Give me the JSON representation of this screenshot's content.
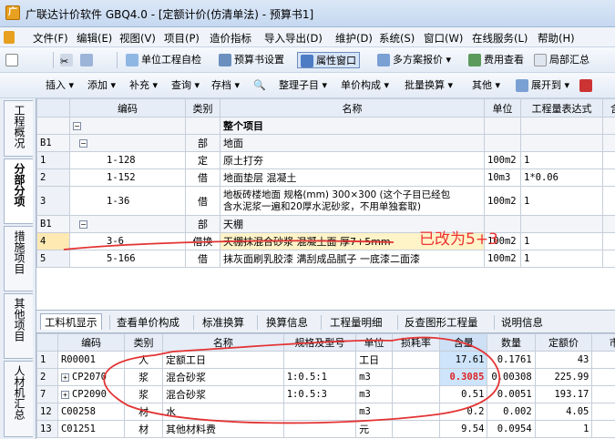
{
  "window": {
    "title": "广联达计价软件 GBQ4.0 - [定额计价(仿清单法) - 预算书1]",
    "app_icon": "广"
  },
  "menu": [
    "文件(F)",
    "编辑(E)",
    "视图(V)",
    "项目(P)",
    "造价指标",
    "导入导出(D)",
    "维护(D)",
    "系统(S)",
    "窗口(W)",
    "在线服务(L)",
    "帮助(H)"
  ],
  "toolbar1": {
    "unit_check": "单位工程自检",
    "budget_settings": "预算书设置",
    "props": "属性窗口",
    "multi_quote": "多方案报价",
    "fee_view": "费用查看",
    "local_summary": "局部汇总"
  },
  "toolbar2": {
    "insert": "插入",
    "add": "添加",
    "fill": "补充",
    "query": "查询",
    "save": "存档",
    "sort": "整理子目",
    "unit_compose": "单价构成",
    "batch_convert": "批量换算",
    "other": "其他",
    "expand": "展开到"
  },
  "side_tabs": [
    "工程概况",
    "分部分项",
    "措施项目",
    "其他项目",
    "人材机汇总"
  ],
  "grid": {
    "headers": [
      "",
      "编码",
      "类别",
      "名称",
      "单位",
      "工程量表达式",
      "含量"
    ],
    "rows": [
      {
        "no": "",
        "code": "",
        "cat": "",
        "name": "整个项目",
        "unit": "",
        "expr": "",
        "qty": ""
      },
      {
        "no": "B1",
        "code": "",
        "cat": "部",
        "name": "地面",
        "unit": "",
        "expr": "",
        "qty": ""
      },
      {
        "no": "1",
        "code": "1-128",
        "cat": "定",
        "name": "原土打夯",
        "unit": "100m2",
        "expr": "1",
        "qty": ""
      },
      {
        "no": "2",
        "code": "1-152",
        "cat": "借",
        "name": "地面垫层 混凝土",
        "unit": "10m3",
        "expr": "1*0.06",
        "qty": ""
      },
      {
        "no": "3",
        "code": "1-36",
        "cat": "借",
        "name": "地板砖楼地面 规格(mm) 300×300 (这个子目已经包",
        "name2": "含水泥浆一遍和20厚水泥砂浆，不用单独套取)",
        "unit": "100m2",
        "expr": "1",
        "qty": ""
      },
      {
        "no": "B1",
        "code": "",
        "cat": "部",
        "name": "天棚",
        "unit": "",
        "expr": "",
        "qty": ""
      },
      {
        "no": "4",
        "code": "3-6",
        "cat": "借换",
        "name": "天棚抹混合砂浆 混凝土面 厚7+5mm",
        "unit": "100m2",
        "expr": "1",
        "qty": ""
      },
      {
        "no": "5",
        "code": "5-166",
        "cat": "借",
        "name": "抹灰面刷乳胶漆 满刮成品腻子 一底漆二面漆",
        "unit": "100m2",
        "expr": "1",
        "qty": ""
      }
    ]
  },
  "annotation": "已改为5+3",
  "bottom_tabs": [
    "工料机显示",
    "查看单价构成",
    "标准换算",
    "换算信息",
    "工程量明细",
    "反查图形工程量",
    "说明信息"
  ],
  "subgrid": {
    "headers": [
      "",
      "编码",
      "类别",
      "名称",
      "规格及型号",
      "单位",
      "损耗率",
      "含量",
      "数量",
      "定额价",
      "市场"
    ],
    "rows": [
      {
        "no": "1",
        "code": "R00001",
        "cat": "人",
        "name": "定额工日",
        "spec": "",
        "unit": "工日",
        "loss": "",
        "qty": "17.61",
        "amount": "0.1761",
        "price": "43"
      },
      {
        "no": "2",
        "code": "CP2070",
        "cat": "浆",
        "name": "混合砂浆",
        "spec": "1:0.5:1",
        "unit": "m3",
        "loss": "",
        "qty": "0.3085",
        "amount": "0.00308",
        "price": "225.99"
      },
      {
        "no": "7",
        "code": "CP2090",
        "cat": "浆",
        "name": "混合砂浆",
        "spec": "1:0.5:3",
        "unit": "m3",
        "loss": "",
        "qty": "0.51",
        "amount": "0.0051",
        "price": "193.17"
      },
      {
        "no": "12",
        "code": "C00258",
        "cat": "材",
        "name": "水",
        "spec": "",
        "unit": "m3",
        "loss": "",
        "qty": "0.2",
        "amount": "0.002",
        "price": "4.05"
      },
      {
        "no": "13",
        "code": "C01251",
        "cat": "材",
        "name": "其他材料费",
        "spec": "",
        "unit": "元",
        "loss": "",
        "qty": "9.54",
        "amount": "0.0954",
        "price": "1"
      }
    ]
  },
  "colors": {
    "annotation": "#e33333",
    "selection": "#ffe9b3",
    "header": "#e6edf7"
  }
}
